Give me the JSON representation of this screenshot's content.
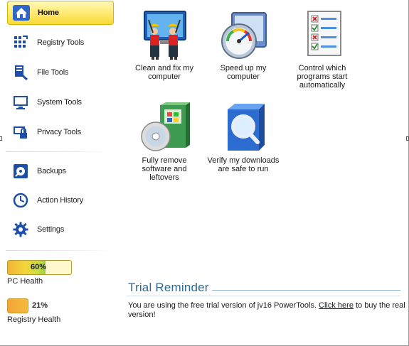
{
  "sidebar": {
    "items": [
      {
        "label": "Home",
        "icon": "home-icon"
      },
      {
        "label": "Registry Tools",
        "icon": "registry-icon"
      },
      {
        "label": "File Tools",
        "icon": "file-tools-icon"
      },
      {
        "label": "System Tools",
        "icon": "monitor-icon"
      },
      {
        "label": "Privacy Tools",
        "icon": "privacy-lock-icon"
      },
      {
        "label": "Backups",
        "icon": "backup-disk-icon"
      },
      {
        "label": "Action History",
        "icon": "clock-icon"
      },
      {
        "label": "Settings",
        "icon": "gear-icon"
      }
    ]
  },
  "health": {
    "pc": {
      "percent": 60,
      "percent_text": "60%",
      "label": "PC Health"
    },
    "registry": {
      "percent": 21,
      "percent_text": "21%",
      "label": "Registry Health"
    }
  },
  "tiles": {
    "clean": {
      "line1": "Clean and fix my",
      "line2": "computer",
      "icon": "workers-cleaning-screen-icon"
    },
    "speed": {
      "line1": "Speed up my",
      "line2": "computer",
      "icon": "speedometer-icon"
    },
    "startup": {
      "line1": "Control which",
      "line2": "programs start",
      "line3": "automatically",
      "icon": "checklist-icon"
    },
    "remove": {
      "line1": "Fully remove",
      "line2": "software and",
      "line3": "leftovers",
      "icon": "software-box-disc-icon"
    },
    "verify": {
      "line1": "Verify my downloads",
      "line2": "are safe to run",
      "icon": "magnifier-box-icon"
    }
  },
  "trial": {
    "title": "Trial Reminder",
    "text_before": "You are using the free trial version of jv16 PowerTools. ",
    "link": "Click here",
    "text_after": " to buy the real version!"
  },
  "colors": {
    "active_nav": "#ffe766",
    "trial_title": "#2b6b95",
    "health_good": "#c7df3f",
    "health_bad": "#f5a437"
  }
}
